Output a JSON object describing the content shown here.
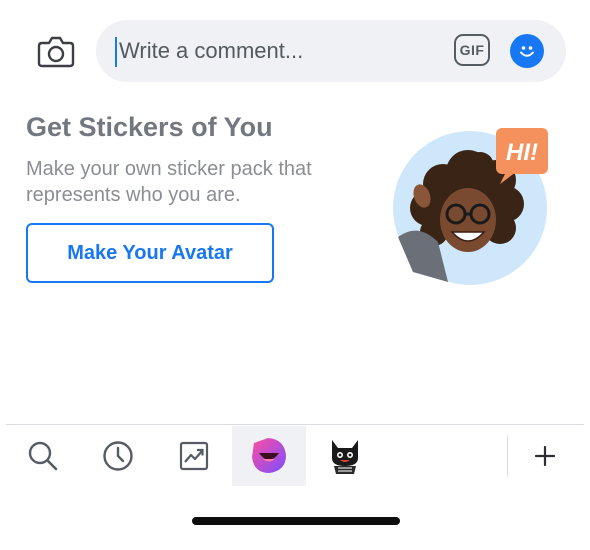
{
  "composer": {
    "placeholder": "Write a comment...",
    "gif_label": "GIF",
    "camera_icon": "camera-icon",
    "emoji_icon": "smiley-icon"
  },
  "promo": {
    "title": "Get Stickers of You",
    "description": "Make your own sticker pack that represents who you are.",
    "button_label": "Make Your Avatar",
    "sticker_text": "HI!"
  },
  "tray": {
    "tabs": [
      {
        "icon": "search-icon"
      },
      {
        "icon": "clock-icon"
      },
      {
        "icon": "trending-icon"
      },
      {
        "icon": "avatar-sticker-icon",
        "selected": true
      },
      {
        "icon": "cat-sticker-icon"
      }
    ],
    "add_icon": "plus-icon"
  },
  "colors": {
    "accent": "#1877f2",
    "input_bg": "#eff1f4",
    "title_gray": "#737880",
    "sticker_orange": "#f4915c"
  }
}
